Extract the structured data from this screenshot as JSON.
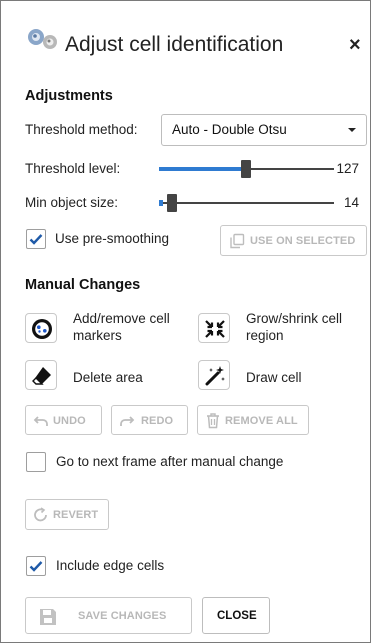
{
  "dialog": {
    "title": "Adjust cell identification",
    "close_glyph": "×"
  },
  "adjustments": {
    "heading": "Adjustments",
    "threshold_method": {
      "label": "Threshold method:",
      "selected": "Auto - Double Otsu"
    },
    "threshold_level": {
      "label": "Threshold level:",
      "value": "127",
      "fraction": 0.5
    },
    "min_object_size": {
      "label": "Min object size:",
      "value": "14",
      "fraction": 0.05
    },
    "pre_smoothing": {
      "label": "Use pre-smoothing",
      "checked": true
    },
    "use_on_selected": {
      "label": "USE ON SELECTED",
      "enabled": false
    }
  },
  "manual_changes": {
    "heading": "Manual Changes",
    "tools": [
      {
        "label": "Add/remove cell markers",
        "icon": "cell-markers-icon"
      },
      {
        "label": "Grow/shrink cell region",
        "icon": "grow-shrink-icon"
      },
      {
        "label": "Delete area",
        "icon": "eraser-icon"
      },
      {
        "label": "Draw cell",
        "icon": "magic-wand-icon"
      }
    ],
    "undo_label": "UNDO",
    "redo_label": "REDO",
    "remove_all_label": "REMOVE ALL",
    "next_frame": {
      "label": "Go to next frame after manual change",
      "checked": false
    },
    "revert_label": "REVERT"
  },
  "include_edge_cells": {
    "label": "Include edge cells",
    "checked": true
  },
  "footer": {
    "save_label": "SAVE CHANGES",
    "close_label": "CLOSE"
  },
  "colors": {
    "accent": "#2f7bd1",
    "check": "#1f5aa8",
    "disabled_text": "#b8b8b8",
    "border": "#c9c9c9"
  }
}
